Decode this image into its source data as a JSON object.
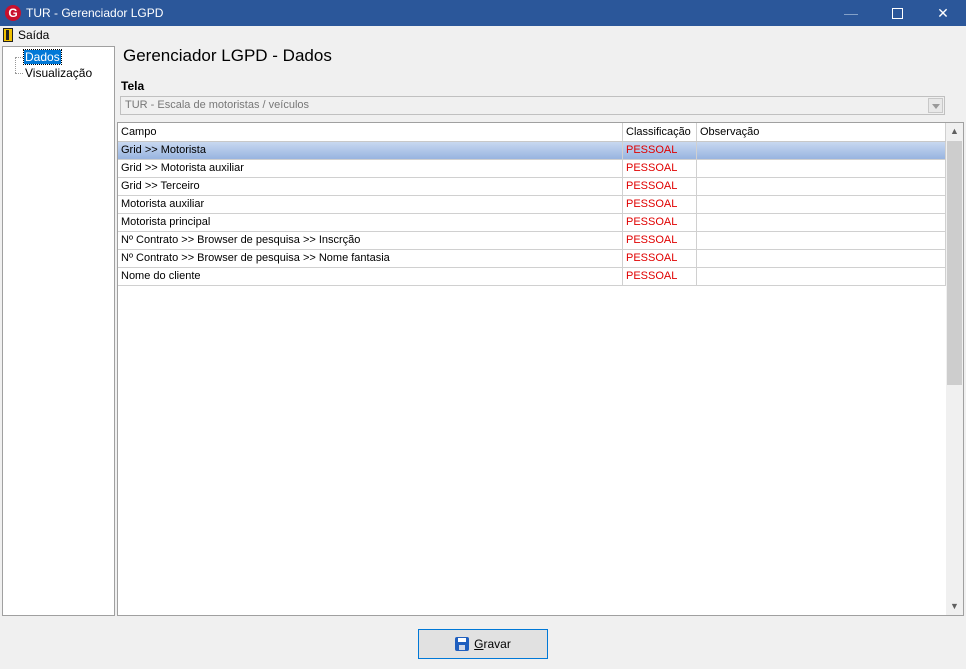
{
  "window": {
    "title": "TUR - Gerenciador LGPD",
    "app_icon": "G"
  },
  "menu": {
    "exit_label": "Saída"
  },
  "tree": {
    "items": [
      {
        "label": "Dados",
        "selected": true
      },
      {
        "label": "Visualização",
        "selected": false
      }
    ]
  },
  "page": {
    "title": "Gerenciador LGPD - Dados"
  },
  "tela": {
    "label": "Tela",
    "value": "TUR - Escala de motoristas / veículos"
  },
  "grid": {
    "columns": [
      "Campo",
      "Classificação",
      "Observação"
    ],
    "rows": [
      {
        "campo": "Grid >> Motorista",
        "classificacao": "PESSOAL",
        "observacao": ""
      },
      {
        "campo": "Grid >> Motorista auxiliar",
        "classificacao": "PESSOAL",
        "observacao": ""
      },
      {
        "campo": "Grid >> Terceiro",
        "classificacao": "PESSOAL",
        "observacao": ""
      },
      {
        "campo": "Motorista auxiliar",
        "classificacao": "PESSOAL",
        "observacao": ""
      },
      {
        "campo": "Motorista principal",
        "classificacao": "PESSOAL",
        "observacao": ""
      },
      {
        "campo": "Nº Contrato >> Browser de pesquisa >> Inscrção",
        "classificacao": "PESSOAL",
        "observacao": ""
      },
      {
        "campo": "Nº Contrato >> Browser de pesquisa >> Nome fantasia",
        "classificacao": "PESSOAL",
        "observacao": ""
      },
      {
        "campo": "Nome do cliente",
        "classificacao": "PESSOAL",
        "observacao": ""
      }
    ]
  },
  "save_button": {
    "accel": "G",
    "rest": "ravar"
  },
  "colors": {
    "titlebar": "#2b579a",
    "classification": "#e00000",
    "selection": "#0078d7"
  },
  "icons": {
    "app": "app-logo-icon",
    "exit": "door-exit-icon",
    "save": "floppy-disk-icon"
  }
}
